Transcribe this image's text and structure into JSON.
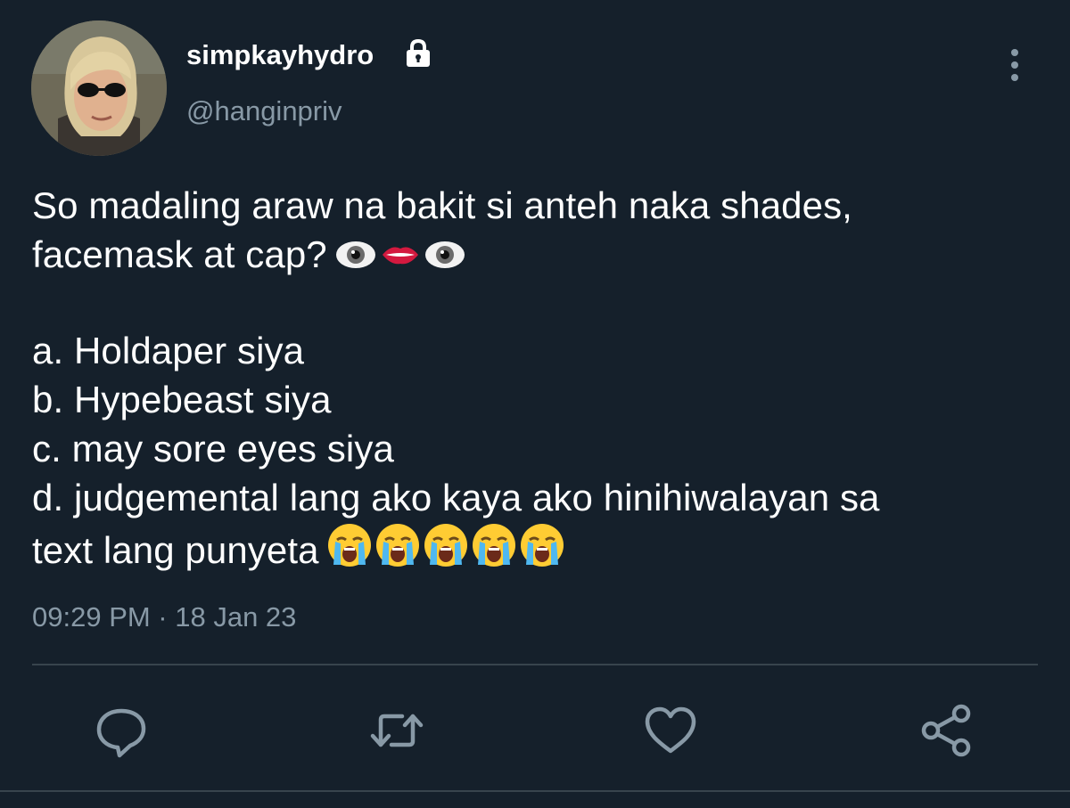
{
  "user": {
    "display_name": "simpkayhydro",
    "handle": "@hanginpriv",
    "protected_icon": "lock-icon",
    "avatar": "profile-avatar"
  },
  "tweet": {
    "line1": "So madaling araw na bakit si anteh naka shades,",
    "line2": "facemask at cap?",
    "line2_emojis": [
      "eye",
      "mouth",
      "eye"
    ],
    "option_a": "a. Holdaper siya",
    "option_b": "b. Hypebeast siya",
    "option_c": "c. may sore eyes siya",
    "option_d_line1": "d. judgemental lang ako kaya ako hinihiwalayan sa",
    "option_d_line2": "text lang punyeta",
    "option_d_emojis": [
      "loudly-crying-face",
      "loudly-crying-face",
      "loudly-crying-face",
      "loudly-crying-face",
      "loudly-crying-face"
    ],
    "timestamp": "09:29 PM · 18 Jan 23"
  },
  "actions": [
    "reply-icon",
    "retweet-icon",
    "like-icon",
    "share-icon"
  ],
  "colors": {
    "background": "#15202b",
    "text": "#ffffff",
    "secondary_text": "#8899a6",
    "divider": "#38444d",
    "icon": "#8899a6"
  }
}
